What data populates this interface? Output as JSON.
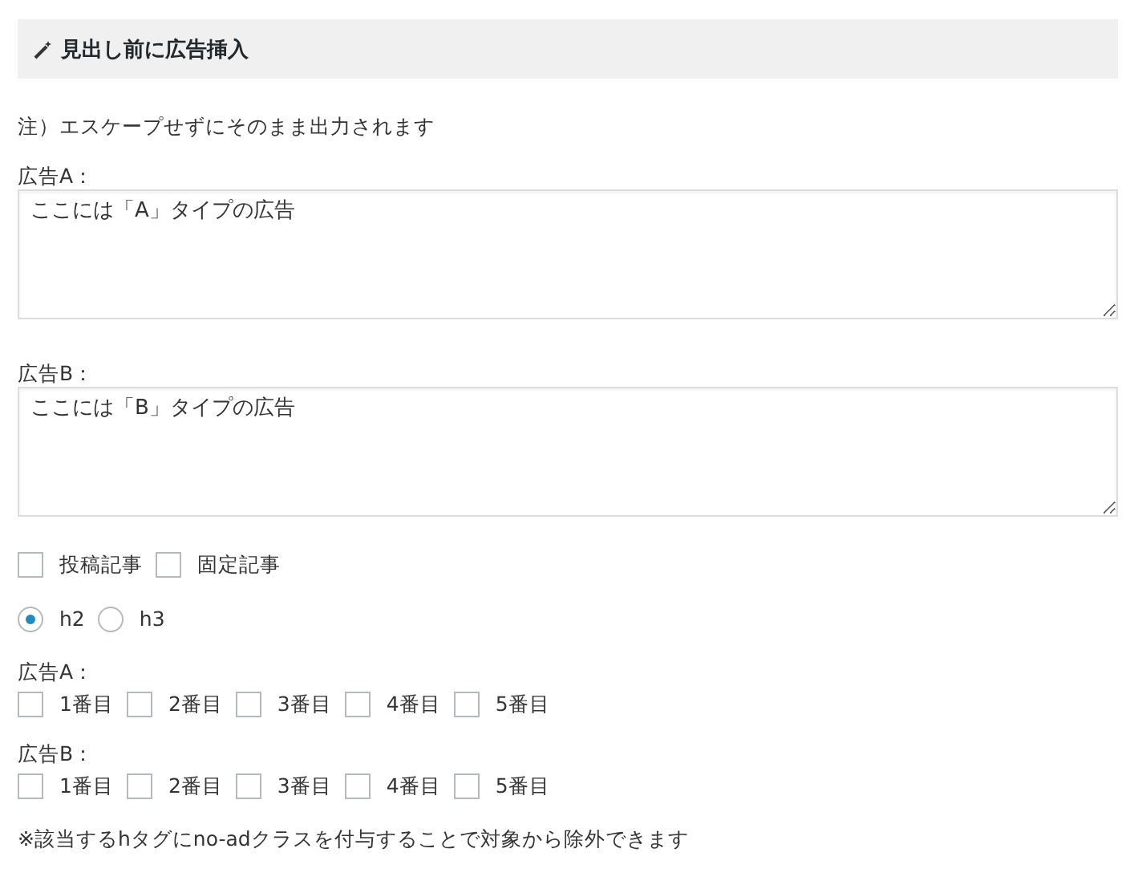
{
  "header": {
    "title": "見出し前に広告挿入"
  },
  "note": "注）エスケープせずにそのまま出力されます",
  "ads": [
    {
      "label": "広告A：",
      "value": "ここには「A」タイプの広告"
    },
    {
      "label": "広告B：",
      "value": "ここには「B」タイプの広告"
    }
  ],
  "post_types": [
    {
      "label": "投稿記事",
      "checked": false
    },
    {
      "label": "固定記事",
      "checked": false
    }
  ],
  "heading_levels": [
    {
      "label": "h2",
      "selected": true
    },
    {
      "label": "h3",
      "selected": false
    }
  ],
  "positions": [
    {
      "label": "広告A：",
      "options": [
        {
          "label": "1番目",
          "checked": false
        },
        {
          "label": "2番目",
          "checked": false
        },
        {
          "label": "3番目",
          "checked": false
        },
        {
          "label": "4番目",
          "checked": false
        },
        {
          "label": "5番目",
          "checked": false
        }
      ]
    },
    {
      "label": "広告B：",
      "options": [
        {
          "label": "1番目",
          "checked": false
        },
        {
          "label": "2番目",
          "checked": false
        },
        {
          "label": "3番目",
          "checked": false
        },
        {
          "label": "4番目",
          "checked": false
        },
        {
          "label": "5番目",
          "checked": false
        }
      ]
    }
  ],
  "footnote": "※該当するhタグにno-adクラスを付与することで対象から除外できます"
}
